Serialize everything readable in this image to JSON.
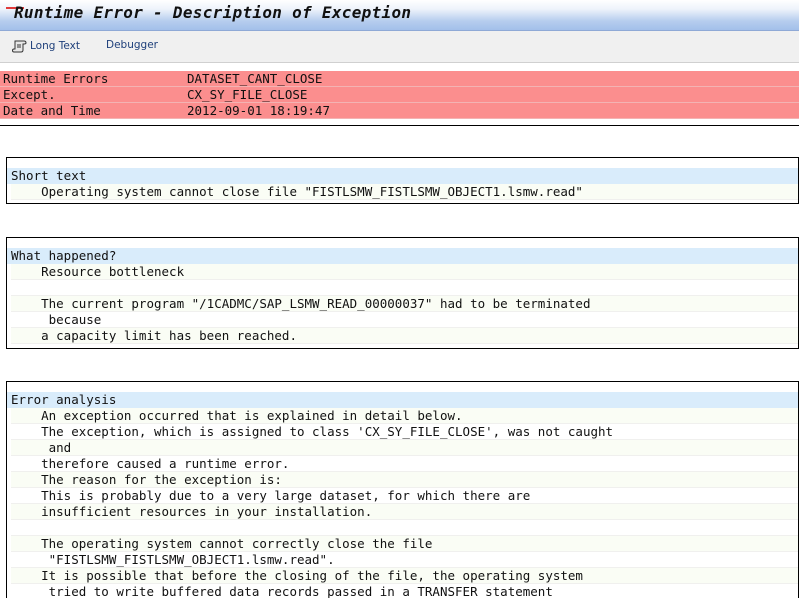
{
  "window": {
    "title": "Runtime Error - Description of Exception"
  },
  "toolbar": {
    "long_text_label": "Long Text",
    "debugger_label": "Debugger"
  },
  "header": {
    "rows": [
      {
        "label": "Runtime Errors",
        "value": "DATASET_CANT_CLOSE"
      },
      {
        "label": "Except.",
        "value": "CX_SY_FILE_CLOSE"
      },
      {
        "label": "Date and Time",
        "value": "2012-09-01 18:19:47"
      }
    ]
  },
  "sections": {
    "short_text": {
      "title": "Short text",
      "lines": [
        "    Operating system cannot close file \"FISTLSMW_FISTLSMW_OBJECT1.lsmw.read\""
      ]
    },
    "what_happened": {
      "title": "What happened?",
      "lines": [
        "    Resource bottleneck",
        "",
        "    The current program \"/1CADMC/SAP_LSMW_READ_00000037\" had to be terminated",
        "     because",
        "    a capacity limit has been reached."
      ]
    },
    "error_analysis": {
      "title": "Error analysis",
      "lines": [
        "    An exception occurred that is explained in detail below.",
        "    The exception, which is assigned to class 'CX_SY_FILE_CLOSE', was not caught",
        "     and",
        "    therefore caused a runtime error.",
        "    The reason for the exception is:",
        "    This is probably due to a very large dataset, for which there are",
        "    insufficient resources in your installation.",
        "",
        "    The operating system cannot correctly close the file",
        "     \"FISTLSMW_FISTLSMW_OBJECT1.lsmw.read\".",
        "    It is possible that before the closing of the file, the operating system",
        "     tried to write buffered data records passed in a TRANSFER statement"
      ]
    }
  }
}
